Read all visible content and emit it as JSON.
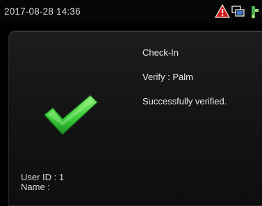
{
  "status_bar": {
    "datetime": "2017-08-28 14:36",
    "icons": [
      "warning-icon",
      "network-icon",
      "usb-icon"
    ]
  },
  "dialog": {
    "event": "Check-In",
    "verify_label": "Verify : Palm",
    "message": "Successfully verified.",
    "user_id_label": "User ID : 1",
    "name_label": "Name :"
  },
  "colors": {
    "check": "#3ed13a",
    "warning": "#d11f1f",
    "background": "#000000"
  }
}
